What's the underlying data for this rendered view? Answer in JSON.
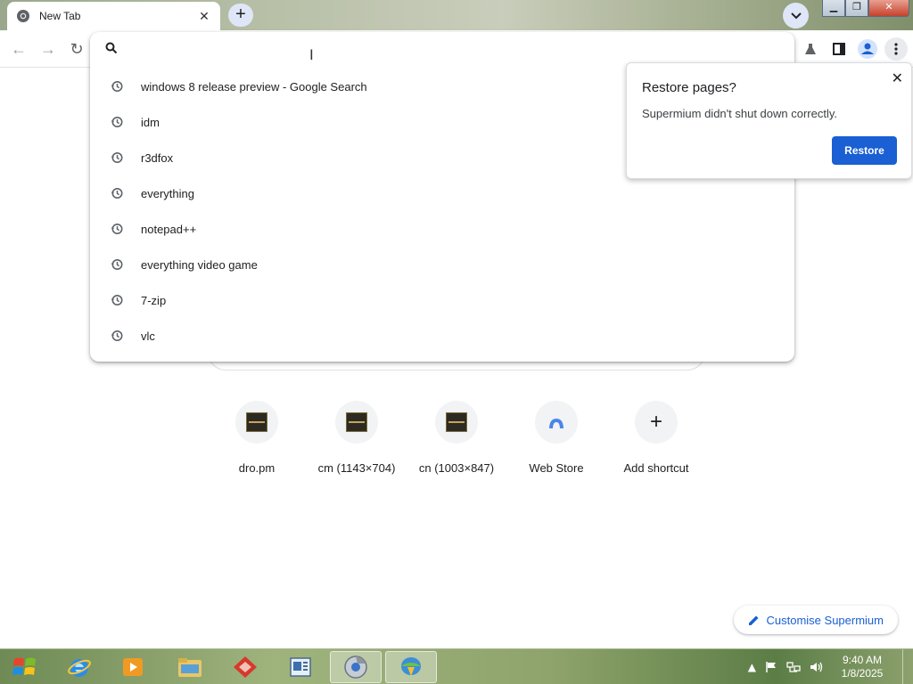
{
  "browser": {
    "tab_title": "New Tab",
    "tab_close": "✕",
    "new_tab": "+",
    "window": {
      "minimize": "▁",
      "maximize": "❐",
      "close": "✕"
    }
  },
  "toolbar": {
    "back": "←",
    "forward": "→",
    "reload": "↻"
  },
  "omnibox": {
    "value": "",
    "suggestions": [
      "windows 8 release preview - Google Search",
      "idm",
      "r3dfox",
      "everything",
      "notepad++",
      "everything video game",
      "7-zip",
      "vlc"
    ]
  },
  "shortcuts": [
    {
      "label": "dro.pm",
      "icon": "thumbnail-icon"
    },
    {
      "label": "cm (1143×704)",
      "icon": "thumbnail-icon"
    },
    {
      "label": "cn (1003×847)",
      "icon": "thumbnail-icon"
    },
    {
      "label": "Web Store",
      "icon": "web-store-icon"
    },
    {
      "label": "Add shortcut",
      "icon": "plus-icon",
      "glyph": "+"
    }
  ],
  "restore_popup": {
    "title": "Restore pages?",
    "message": "Supermium didn't shut down correctly.",
    "button": "Restore",
    "close": "✕"
  },
  "customise_button": "Customise Supermium",
  "taskbar": {
    "time": "9:40 AM",
    "date": "1/8/2025",
    "tray_arrow": "▲"
  },
  "colors": {
    "accent": "#1a5fd3",
    "tab_button_bg": "#dfe6f7"
  }
}
